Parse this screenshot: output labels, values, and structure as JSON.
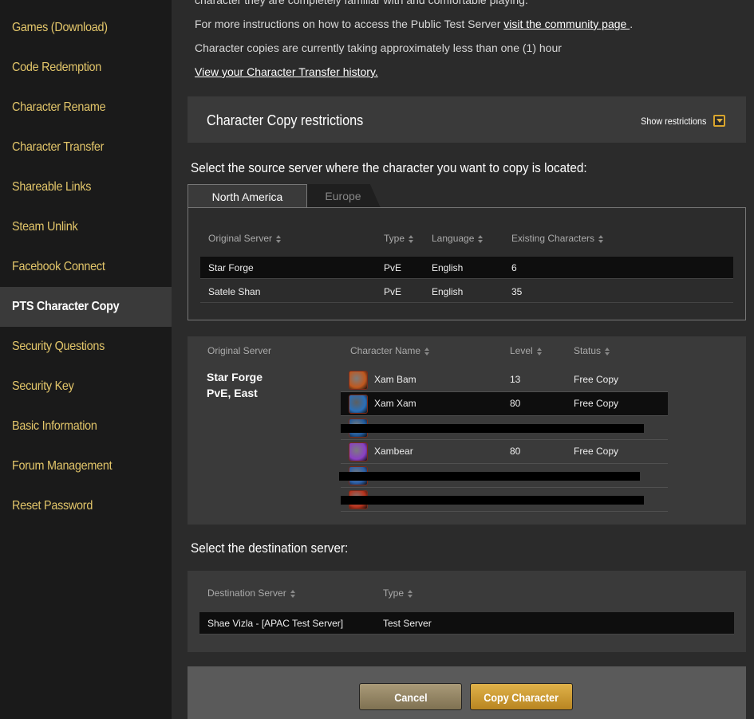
{
  "sidebar": {
    "items": [
      {
        "label": "Games (Download)"
      },
      {
        "label": "Code Redemption"
      },
      {
        "label": "Character Rename"
      },
      {
        "label": "Character Transfer"
      },
      {
        "label": "Shareable Links"
      },
      {
        "label": "Steam Unlink"
      },
      {
        "label": "Facebook Connect"
      },
      {
        "label": "PTS Character Copy",
        "active": true
      },
      {
        "label": "Security Questions"
      },
      {
        "label": "Security Key"
      },
      {
        "label": "Basic Information"
      },
      {
        "label": "Forum Management"
      },
      {
        "label": "Reset Password"
      }
    ]
  },
  "intro": {
    "line0": "character they are completely familiar with and comfortable playing.",
    "line1_prefix": "For more instructions on how to access the Public Test Server ",
    "line1_link": "visit the community page ",
    "line1_suffix": ".",
    "line2": "Character copies are currently taking approximately less than one (1) hour",
    "history_link": "View your Character Transfer history."
  },
  "restrictions": {
    "title": "Character Copy restrictions",
    "toggle_label": "Show restrictions"
  },
  "source": {
    "heading": "Select the source server where the character you want to copy is located:",
    "tabs": [
      {
        "label": "North America",
        "active": true
      },
      {
        "label": "Europe",
        "active": false
      }
    ],
    "columns": [
      "Original Server",
      "Type",
      "Language",
      "Existing Characters"
    ],
    "rows": [
      {
        "server": "Star Forge",
        "type": "PvE",
        "language": "English",
        "count": "6",
        "selected": true
      },
      {
        "server": "Satele Shan",
        "type": "PvE",
        "language": "English",
        "count": "35",
        "selected": false
      }
    ]
  },
  "characters": {
    "columns": [
      "Original Server",
      "Character Name",
      "Level",
      "Status"
    ],
    "server_name": "Star Forge",
    "server_detail": "PvE, East",
    "rows": [
      {
        "name": "Xam Bam",
        "level": "13",
        "status": "Free Copy",
        "avatar_color": "#c0581e"
      },
      {
        "name": "Xam Xam",
        "level": "80",
        "status": "Free Copy",
        "avatar_color": "#2a6fb8",
        "selected": true
      },
      {
        "name": "",
        "level": "",
        "status": "",
        "avatar_color": "#1f5a9c",
        "redacted": true
      },
      {
        "name": "Xambear",
        "level": "80",
        "status": "Free Copy",
        "avatar_color": "#8a3fc4"
      },
      {
        "name": "",
        "level": "",
        "status": "",
        "avatar_color": "#2a5fa8",
        "redacted": true
      },
      {
        "name": "",
        "level": "",
        "status": "",
        "avatar_color": "#b8321c",
        "redacted": true
      }
    ]
  },
  "destination": {
    "heading": "Select the destination server:",
    "columns": [
      "Destination Server",
      "Type"
    ],
    "rows": [
      {
        "server": "Shae Vizla - [APAC Test Server]",
        "type": "Test Server",
        "selected": true
      }
    ]
  },
  "actions": {
    "cancel": "Cancel",
    "copy": "Copy Character"
  }
}
